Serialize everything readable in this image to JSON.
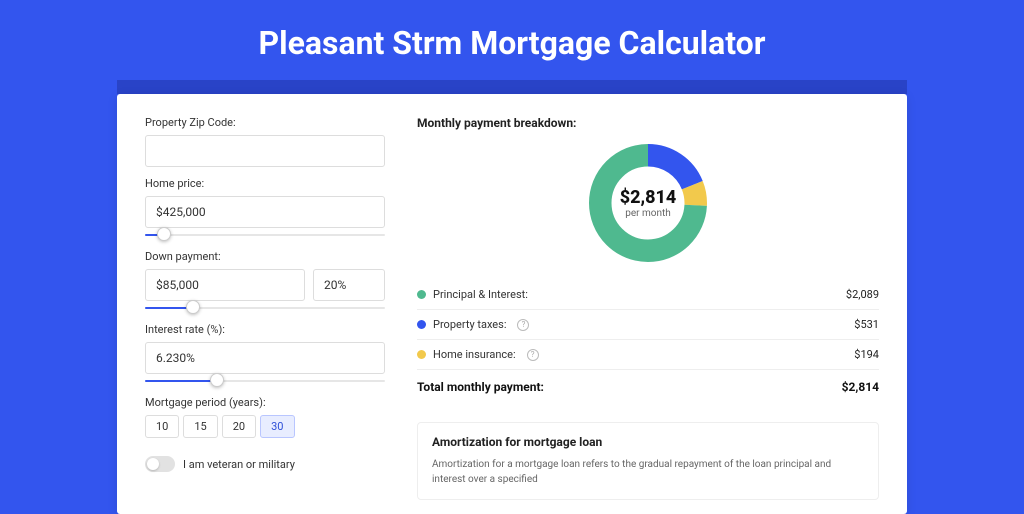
{
  "title": "Pleasant Strm Mortgage Calculator",
  "form": {
    "zip_label": "Property Zip Code:",
    "zip_value": "",
    "home_price_label": "Home price:",
    "home_price_value": "$425,000",
    "home_price_slider_pct": 8,
    "down_payment_label": "Down payment:",
    "down_payment_value": "$85,000",
    "down_payment_pct_value": "20%",
    "down_payment_slider_pct": 20,
    "interest_label": "Interest rate (%):",
    "interest_value": "6.230%",
    "interest_slider_pct": 30,
    "period_label": "Mortgage period (years):",
    "period_options": [
      "10",
      "15",
      "20",
      "30"
    ],
    "period_selected": "30",
    "veteran_label": "I am veteran or military"
  },
  "breakdown": {
    "title": "Monthly payment breakdown:",
    "center_amount": "$2,814",
    "center_sub": "per month",
    "items": [
      {
        "label": "Principal & Interest:",
        "value": "$2,089",
        "color": "#4fb98f",
        "info": false,
        "pct": 74.24
      },
      {
        "label": "Property taxes:",
        "value": "$531",
        "color": "#3355ee",
        "info": true,
        "pct": 18.87
      },
      {
        "label": "Home insurance:",
        "value": "$194",
        "color": "#f2c94c",
        "info": true,
        "pct": 6.89
      }
    ],
    "total_label": "Total monthly payment:",
    "total_value": "$2,814"
  },
  "amort": {
    "title": "Amortization for mortgage loan",
    "text": "Amortization for a mortgage loan refers to the gradual repayment of the loan principal and interest over a specified"
  },
  "chart_data": {
    "type": "pie",
    "title": "Monthly payment breakdown",
    "categories": [
      "Principal & Interest",
      "Property taxes",
      "Home insurance"
    ],
    "values": [
      2089,
      531,
      194
    ],
    "colors": [
      "#4fb98f",
      "#3355ee",
      "#f2c94c"
    ],
    "total": 2814
  }
}
